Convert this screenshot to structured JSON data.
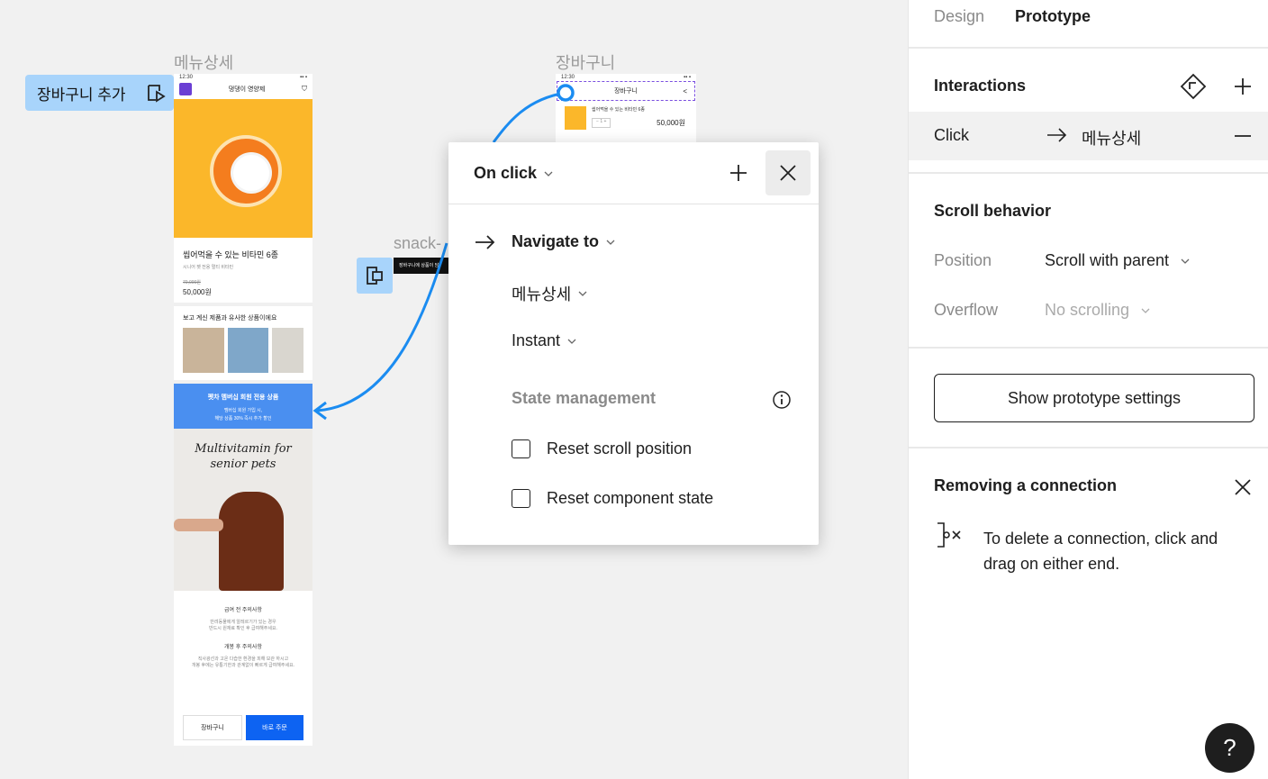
{
  "panel": {
    "tabs": [
      "Design",
      "Prototype"
    ],
    "interactions_title": "Interactions",
    "click_trigger": "Click",
    "click_target": "메뉴상세",
    "scroll_title": "Scroll behavior",
    "position_label": "Position",
    "position_value": "Scroll with parent",
    "overflow_label": "Overflow",
    "overflow_value": "No scrolling",
    "settings_button": "Show prototype settings",
    "removing_title": "Removing a connection",
    "removing_text_1": "To delete a connection, click and",
    "removing_text_2": "drag on either end."
  },
  "popup": {
    "trigger": "On click",
    "action": "Navigate to",
    "destination": "메뉴상세",
    "animation": "Instant",
    "state_title": "State management",
    "reset_scroll": "Reset scroll position",
    "reset_component": "Reset component state"
  },
  "canvas": {
    "frame1_label": "메뉴상세",
    "frame2_label": "장바구니",
    "trigger_tag": "장바구니 추가",
    "snack_label": "snack-",
    "snack_text": "장바구니에 상품이 담",
    "phone1": {
      "time": "12:30",
      "title": "댕댕이 영양제",
      "product_name": "씹어먹을 수 있는 비타민 6종",
      "product_sub": "시니어 펫 전용 멀티 비타민",
      "old_price": "70,000원",
      "price": "50,000원",
      "similar_title": "보고 계신 제품과 유사한 상품이에요",
      "banner_title": "펫차 멤버십 회원 전용 상품",
      "banner_sub_1": "멤버십 회원 가입 시,",
      "banner_sub_2": "해당 상품 30% 즉시 추가 할인",
      "script_1": "Multivitamin for",
      "script_2": "senior pets",
      "notice1_title": "급여 전 주의사항",
      "notice1_l1": "반려동물에게 알레르기가 있는 경우",
      "notice1_l2": "반드시 원재료 확인 후 급여해주세요.",
      "notice2_title": "개봉 후 주의사항",
      "notice2_l1": "직사광선과 고온 다습한 환경을 피해 보관 하시고",
      "notice2_l2": "개봉 후에는 유통기한과 관계없이 빠르게 급여해주세요.",
      "btn_cart": "장바구니",
      "btn_buy": "바로 주문"
    },
    "phone2": {
      "time": "12:30",
      "title": "장바구니",
      "item": "씹어먹을 수 있는 비타민 6종",
      "qty": "1",
      "price": "50,000원"
    }
  },
  "colors": {
    "accent_blue": "#1b8cf1",
    "tag_blue": "#a8d4fb",
    "banner_blue": "#4a8ff0",
    "buy_blue": "#0d63f2",
    "orange": "#fbb72a"
  }
}
